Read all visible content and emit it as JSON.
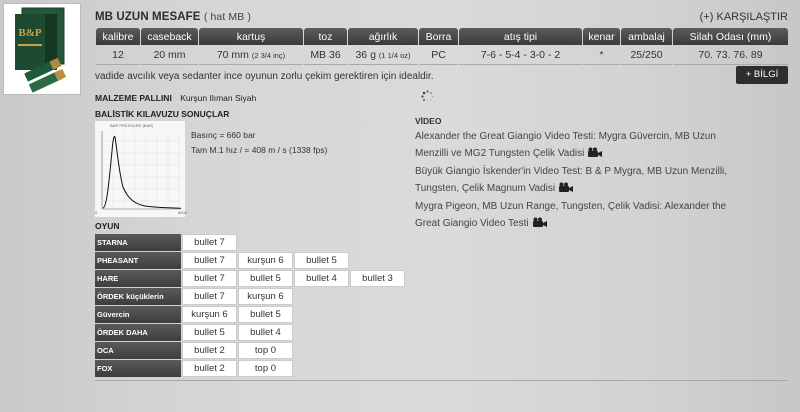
{
  "product": {
    "title": "MB UZUN MESAFE",
    "subtitle": "( hat MB )",
    "compare": "(+) KARŞILAŞTIR",
    "image_text": "B&P"
  },
  "specs": {
    "headers": [
      "kalibre",
      "caseback",
      "kartuş",
      "toz",
      "ağırlık",
      "Borra",
      "atış tipi",
      "kenar",
      "ambalaj",
      "Silah Odası (mm)"
    ],
    "values": {
      "kalibre": "12",
      "caseback": "20 mm",
      "kartus_main": "70 mm",
      "kartus_sub": "(2 3/4 inç)",
      "toz": "MB 36",
      "agirlik_main": "36 g",
      "agirlik_sub": "(1 1/4 oz)",
      "borra": "PC",
      "atis_tipi": "7-6 - 5-4 - 3-0 - 2",
      "kenar": "*",
      "ambalaj": "25/250",
      "silah_odasi": "70. 73. 76. 89"
    }
  },
  "description": "vadide avcılık veya sedanter ince oyunun zorlu çekim gerektiren için idealdir.",
  "info_button": "+ BİLGİ",
  "material": {
    "label": "MALZEME PALLINI",
    "value": "Kurşun Ilıman Siyah"
  },
  "ballistic": {
    "title": "BALİSTİK KILAVUZU SONUÇLAR",
    "pressure_line": "Basınç = 660 bar",
    "speed_line": "Tam M.1 hız / = 408 m / s (1338 fps)",
    "graph_label": "BAR PRESSURE (BAR)",
    "axis_left": "0",
    "axis_right": "8000"
  },
  "video": {
    "title": "VİDEO",
    "items": [
      "Alexander the Great Giangio Video Testi: Mygra Güvercin, MB Uzun Menzilli ve MG2 Tungsten Çelik Vadisi",
      "Büyük Giangio İskender'in Video Test: B & P Mygra, MB Uzun Menzilli, Tungsten, Çelik Magnum Vadisi",
      "Mygra Pigeon, MB Uzun Range, Tungsten, Çelik Vadisi: Alexander the Great Giangio Video Testi"
    ]
  },
  "game": {
    "title": "OYUN",
    "rows": [
      {
        "name": "STARNA",
        "cells": [
          "bullet 7"
        ]
      },
      {
        "name": "PHEASANT",
        "cells": [
          "bullet 7",
          "kurşun 6",
          "bullet 5"
        ]
      },
      {
        "name": "HARE",
        "cells": [
          "bullet 7",
          "bullet 5",
          "bullet 4",
          "bullet 3"
        ]
      },
      {
        "name": "ÖRDEK küçüklerin",
        "cells": [
          "bullet 7",
          "kurşun 6"
        ]
      },
      {
        "name": "Güvercin",
        "cells": [
          "kurşun 6",
          "bullet 5"
        ]
      },
      {
        "name": "ÖRDEK DAHA",
        "cells": [
          "bullet 5",
          "bullet 4"
        ]
      },
      {
        "name": "OCA",
        "cells": [
          "bullet 2",
          "top 0"
        ]
      },
      {
        "name": "FOX",
        "cells": [
          "bullet 2",
          "top 0"
        ]
      }
    ]
  },
  "colors": {
    "header_bg": "#3a3a3a",
    "card_bg": "#d6d6d6",
    "box_green": "#1f4d32",
    "shell_gold": "#b08a3e"
  },
  "icons": [
    "video-camera-icon",
    "loading-spinner-icon"
  ]
}
